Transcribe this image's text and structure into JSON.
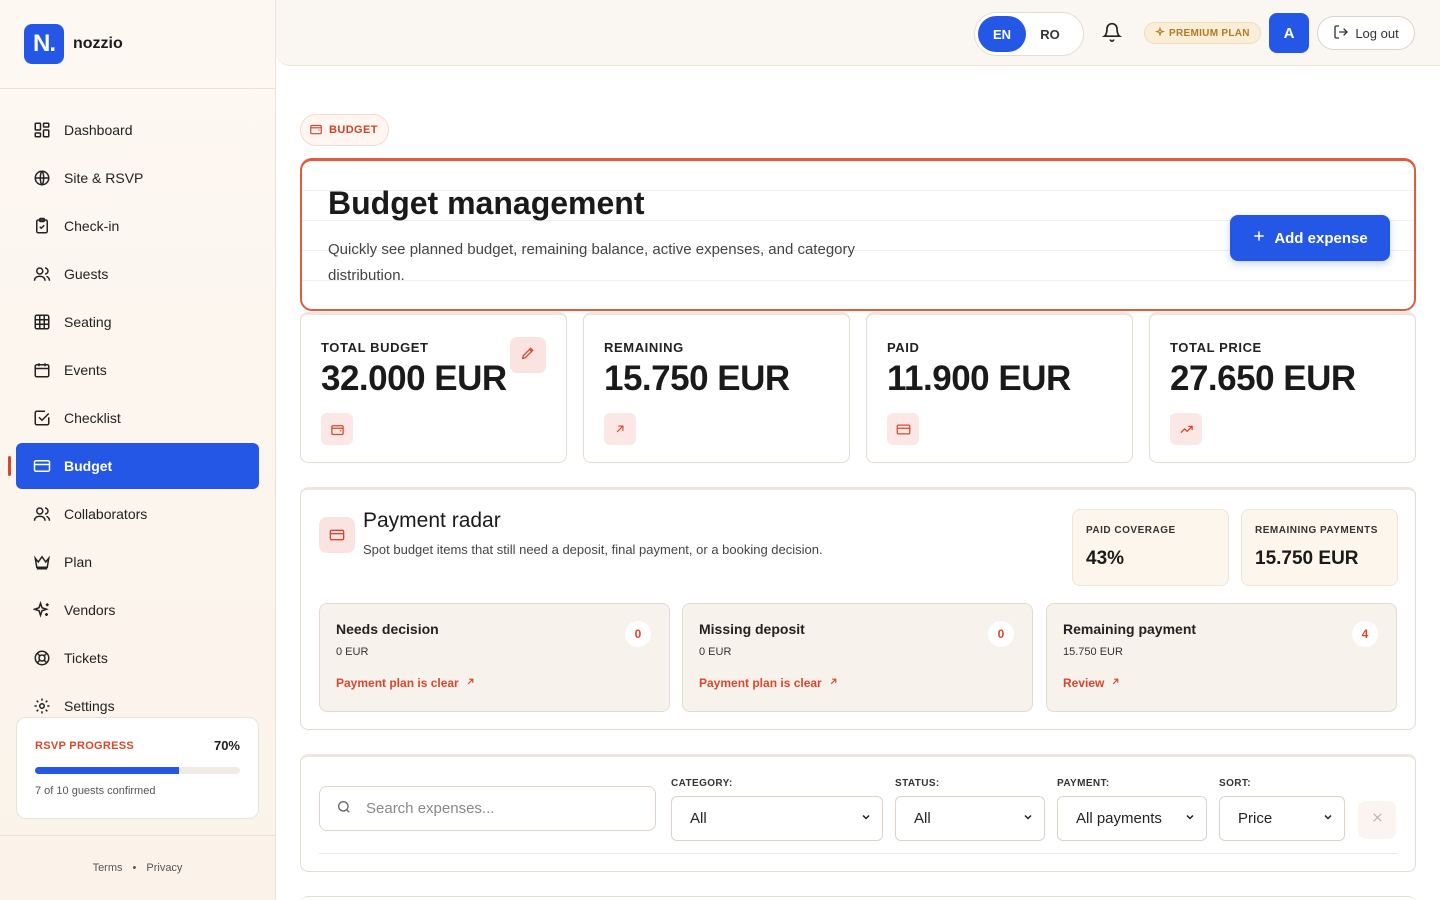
{
  "brand": {
    "logo": "N.",
    "name": "nozzio"
  },
  "nav": [
    {
      "label": "Dashboard",
      "icon": "dashboard-icon"
    },
    {
      "label": "Site & RSVP",
      "icon": "globe-icon"
    },
    {
      "label": "Check-in",
      "icon": "clipboard-check-icon"
    },
    {
      "label": "Guests",
      "icon": "users-icon"
    },
    {
      "label": "Seating",
      "icon": "grid-icon"
    },
    {
      "label": "Events",
      "icon": "calendar-icon"
    },
    {
      "label": "Checklist",
      "icon": "checkbox-icon"
    },
    {
      "label": "Budget",
      "icon": "credit-card-icon",
      "active": true
    },
    {
      "label": "Collaborators",
      "icon": "users-icon"
    },
    {
      "label": "Plan",
      "icon": "crown-icon"
    },
    {
      "label": "Vendors",
      "icon": "sparkles-icon"
    },
    {
      "label": "Tickets",
      "icon": "lifebuoy-icon"
    },
    {
      "label": "Settings",
      "icon": "gear-icon"
    }
  ],
  "rsvp": {
    "label": "RSVP PROGRESS",
    "percent": "70%",
    "progress": 0.7,
    "subtitle": "7 of 10 guests confirmed"
  },
  "footer": {
    "terms": "Terms",
    "separator": "•",
    "privacy": "Privacy"
  },
  "topbar": {
    "lang_en": "EN",
    "lang_ro": "RO",
    "active_lang": "EN",
    "premium": "PREMIUM PLAN",
    "avatar": "A",
    "logout": "Log out"
  },
  "breadcrumb": "BUDGET",
  "hero": {
    "title": "Budget management",
    "subtitle": "Quickly see planned budget, remaining balance, active expenses, and category distribution.",
    "add_button": "Add expense"
  },
  "stats": [
    {
      "label": "TOTAL BUDGET",
      "value": "32.000 EUR",
      "icon": "wallet-icon"
    },
    {
      "label": "REMAINING",
      "value": "15.750 EUR",
      "icon": "arrow-up-right-icon"
    },
    {
      "label": "PAID",
      "value": "11.900 EUR",
      "icon": "credit-card-icon"
    },
    {
      "label": "TOTAL PRICE",
      "value": "27.650 EUR",
      "icon": "trending-up-icon"
    }
  ],
  "radar": {
    "title": "Payment radar",
    "description": "Spot budget items that still need a deposit, final payment, or a booking decision.",
    "paid_coverage_label": "PAID COVERAGE",
    "paid_coverage_value": "43%",
    "remaining_label": "REMAINING PAYMENTS",
    "remaining_value": "15.750 EUR",
    "cards": [
      {
        "title": "Needs decision",
        "amount": "0 EUR",
        "link": "Payment plan is clear",
        "count": "0"
      },
      {
        "title": "Missing deposit",
        "amount": "0 EUR",
        "link": "Payment plan is clear",
        "count": "0"
      },
      {
        "title": "Remaining payment",
        "amount": "15.750 EUR",
        "link": "Review",
        "count": "4"
      }
    ]
  },
  "filters": {
    "search_placeholder": "Search expenses...",
    "category_label": "CATEGORY:",
    "category_value": "All",
    "status_label": "STATUS:",
    "status_value": "All",
    "payment_label": "PAYMENT:",
    "payment_value": "All payments",
    "sort_label": "SORT:",
    "sort_value": "Price"
  },
  "colors": {
    "accent": "#2457e6",
    "brand_red": "#d9472b"
  }
}
